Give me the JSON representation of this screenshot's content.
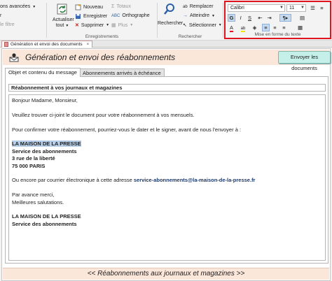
{
  "ribbon": {
    "partial": {
      "item1": "ons avancées",
      "item2": "r",
      "item3": "le filtre"
    },
    "records": {
      "refresh_label_1": "Actualiser",
      "refresh_label_2": "tout",
      "new": "Nouveau",
      "save": "Enregistrer",
      "delete": "Supprimer",
      "totals": "Totaux",
      "spelling": "Orthographe",
      "more": "Plus",
      "group_label": "Enregistrements"
    },
    "find": {
      "search": "Rechercher",
      "replace": "Remplacer",
      "goto": "Atteindre",
      "select": "Sélectionner",
      "group_label": "Rechercher"
    },
    "text_format": {
      "font": "Calibri",
      "size": "11",
      "bold": "G",
      "italic": "I",
      "underline": "S",
      "font_color": "A",
      "highlight": "ab",
      "group_label": "Mise en forme du texte",
      "highlight_color": "#e0141e"
    }
  },
  "doc_tab": {
    "label": "Génération et envoi des documents",
    "close": "×"
  },
  "form": {
    "title": "Génération et envoi des réabonnements",
    "send_button": "Envoyer les documents",
    "tabs": [
      {
        "label": "Objet et contenu du message"
      },
      {
        "label": "Abonnements arrivés à échéance"
      }
    ],
    "subject": "Réabonnement à vos journaux et magazines",
    "body": {
      "greeting": "Bonjour Madame, Monsieur,",
      "line1": "Veuillez trouver ci-joint le document pour votre réabonnement à vos mensuels.",
      "line2": "Pour confirmer votre réabonnement, pourriez-vous le dater et le signer, avant de nous l'envoyer à :",
      "addr1": "LA MAISON DE LA PRESSE",
      "addr2": "Service des abonnements",
      "addr3": "3 rue de la liberté",
      "addr4": "75 000 PARIS",
      "email_intro": "Ou encore par courrier électronique à cette adresse ",
      "email": "service-abonnements@la-maison-de-la-presse.fr",
      "thanks": "Par avance merci,",
      "regards": "Meilleures salutations.",
      "sig1": "LA MAISON DE LA PRESSE",
      "sig2": "Service des abonnements"
    },
    "footer": "<< Réabonnements aux journaux et magazines >>"
  },
  "colors": {
    "header_bg": "#fbe6da",
    "send_button_bg": "#c5efe9",
    "selection": "#b7cfe9"
  }
}
